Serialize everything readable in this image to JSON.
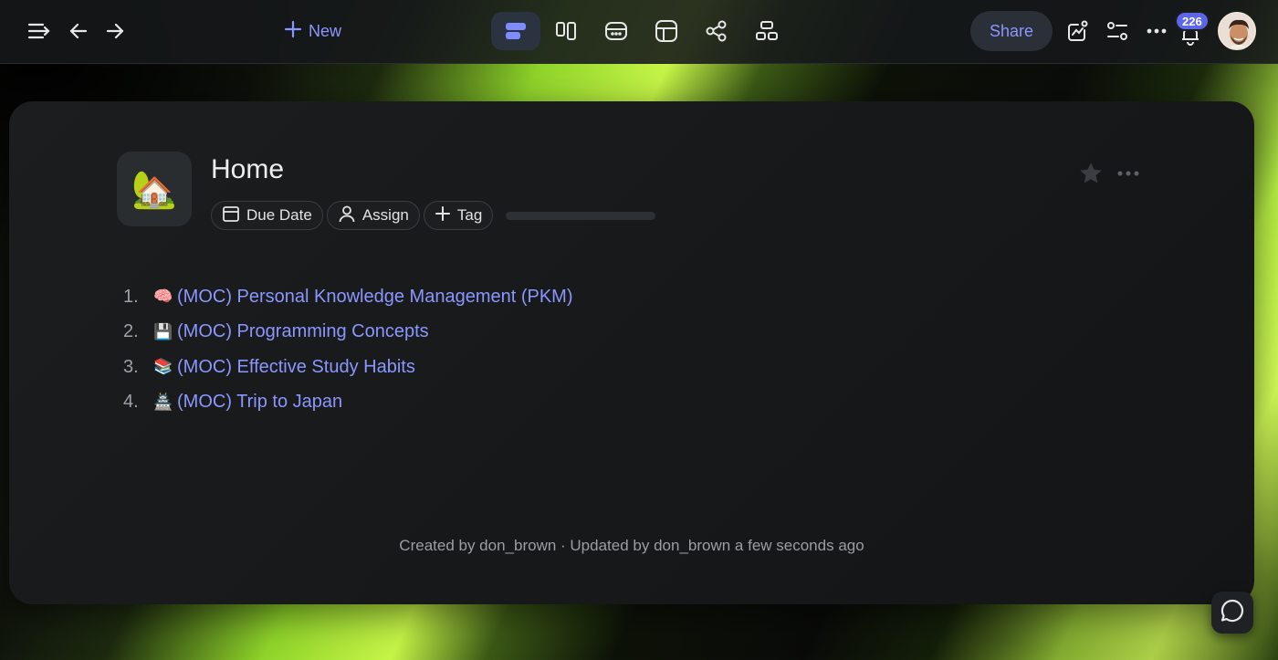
{
  "topbar": {
    "new_label": "New",
    "share_label": "Share",
    "notification_count": "226",
    "icons": [
      "sidebar-toggle-icon",
      "back-arrow-icon",
      "forward-arrow-icon",
      "plus-icon",
      "list-view-icon",
      "board-view-icon",
      "calendar-view-icon",
      "table-view-icon",
      "graph-view-icon",
      "tree-view-icon",
      "insights-icon",
      "filter-icon",
      "more-icon",
      "bell-icon"
    ]
  },
  "page": {
    "icon": "🏡",
    "title": "Home",
    "chips": [
      {
        "label": "Due Date",
        "icon": "calendar-icon"
      },
      {
        "label": "Assign",
        "icon": "person-icon"
      },
      {
        "label": "Tag",
        "icon": "plus-icon"
      }
    ],
    "items": [
      {
        "num": "1.",
        "emoji": "🧠",
        "label": "(MOC) Personal Knowledge Management (PKM)"
      },
      {
        "num": "2.",
        "emoji": "💾",
        "label": "(MOC) Programming Concepts"
      },
      {
        "num": "3.",
        "emoji": "📚",
        "label": "(MOC) Effective Study Habits"
      },
      {
        "num": "4.",
        "emoji": "🏯",
        "label": "(MOC) Trip to Japan"
      }
    ],
    "meta": "Created by don_brown · Updated by don_brown a few seconds ago"
  },
  "colors": {
    "accent": "#8b97ff",
    "badge": "#5b67e6",
    "card_bg": "#1b1d1f"
  }
}
